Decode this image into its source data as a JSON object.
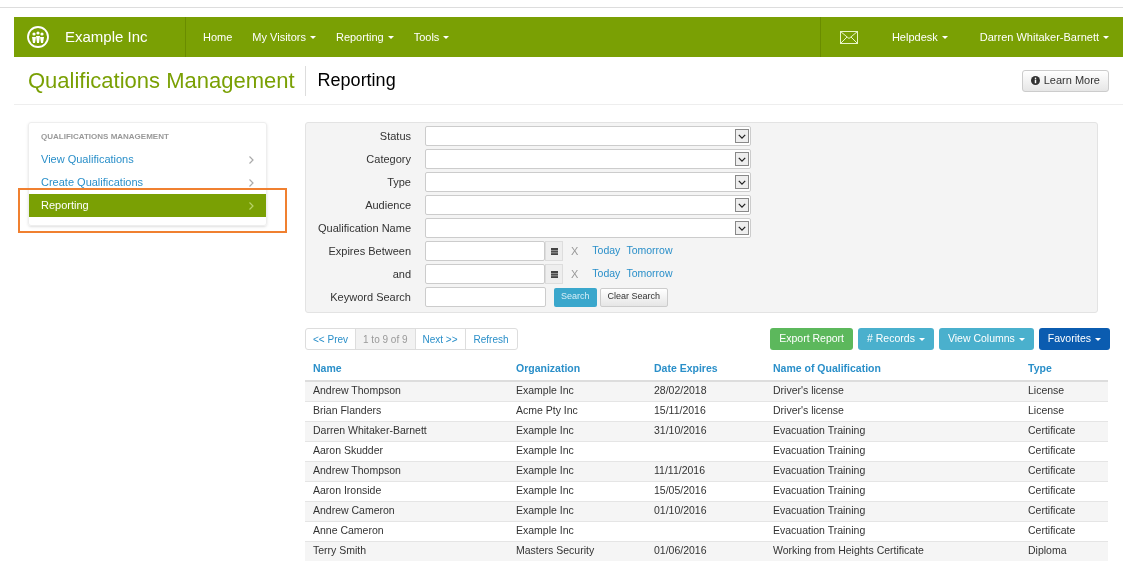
{
  "navbar": {
    "brand": "Example Inc",
    "menu": [
      {
        "label": "Home",
        "dropdown": false
      },
      {
        "label": "My Visitors",
        "dropdown": true
      },
      {
        "label": "Reporting",
        "dropdown": true
      },
      {
        "label": "Tools",
        "dropdown": true
      }
    ],
    "right_menu": [
      {
        "label": "Helpdesk",
        "dropdown": true
      },
      {
        "label": "Darren Whitaker-Barnett",
        "dropdown": true
      }
    ]
  },
  "header": {
    "title": "Qualifications Management",
    "subtitle": "Reporting",
    "help_button": "Learn More"
  },
  "sidebar": {
    "heading": "QUALIFICATIONS MANAGEMENT",
    "items": [
      {
        "label": "View Qualifications",
        "selected": false
      },
      {
        "label": "Create Qualifications",
        "selected": false
      },
      {
        "label": "Reporting",
        "selected": true
      }
    ]
  },
  "filters": [
    {
      "kind": "select",
      "label": "Status"
    },
    {
      "kind": "select",
      "label": "Category"
    },
    {
      "kind": "select",
      "label": "Type"
    },
    {
      "kind": "select",
      "label": "Audience"
    },
    {
      "kind": "select",
      "label": "Qualification Name"
    },
    {
      "kind": "date",
      "label": "Expires Between",
      "clear": "X",
      "shortcuts": [
        "Today",
        "Tomorrow"
      ]
    },
    {
      "kind": "date",
      "label": "and",
      "clear": "X",
      "shortcuts": [
        "Today",
        "Tomorrow"
      ]
    },
    {
      "kind": "text",
      "label": "Keyword Search",
      "buttons": [
        "Search",
        "Clear Search"
      ]
    }
  ],
  "pager": {
    "prev": "<< Prev",
    "range": "1 to 9 of 9",
    "next": "Next >>",
    "refresh": "Refresh"
  },
  "actions": [
    {
      "label": "Export Report",
      "kind": "success",
      "dropdown": false
    },
    {
      "label": "# Records",
      "kind": "info",
      "dropdown": true
    },
    {
      "label": "View Columns",
      "kind": "info",
      "dropdown": true
    },
    {
      "label": "Favorites",
      "kind": "primary",
      "dropdown": true
    }
  ],
  "table": {
    "columns": [
      "Name",
      "Organization",
      "Date Expires",
      "Name of Qualification",
      "Type"
    ],
    "rows": [
      [
        "Andrew Thompson",
        "Example Inc",
        "28/02/2018",
        "Driver's license",
        "License"
      ],
      [
        "Brian Flanders",
        "Acme Pty Inc",
        "15/11/2016",
        "Driver's license",
        "License"
      ],
      [
        "Darren Whitaker-Barnett",
        "Example Inc",
        "31/10/2016",
        "Evacuation Training",
        "Certificate"
      ],
      [
        "Aaron Skudder",
        "Example Inc",
        "",
        "Evacuation Training",
        "Certificate"
      ],
      [
        "Andrew Thompson",
        "Example Inc",
        "11/11/2016",
        "Evacuation Training",
        "Certificate"
      ],
      [
        "Aaron Ironside",
        "Example Inc",
        "15/05/2016",
        "Evacuation Training",
        "Certificate"
      ],
      [
        "Andrew Cameron",
        "Example Inc",
        "01/10/2016",
        "Evacuation Training",
        "Certificate"
      ],
      [
        "Anne Cameron",
        "Example Inc",
        "",
        "Evacuation Training",
        "Certificate"
      ],
      [
        "Terry Smith",
        "Masters Security",
        "01/06/2016",
        "Working from Heights Certificate",
        "Diploma"
      ]
    ]
  }
}
